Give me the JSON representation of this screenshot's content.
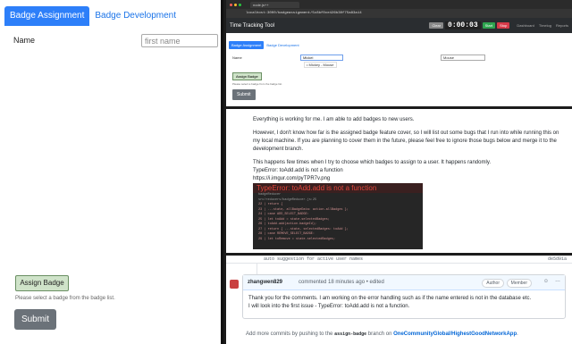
{
  "left_panel": {
    "tabs": [
      "Badge Assignment",
      "Badge Development"
    ],
    "name_label": "Name",
    "name_placeholder": "first name",
    "assign_button": "Assign Badge",
    "hint": "Please select a badge from the badge list.",
    "submit_button": "Submit"
  },
  "browser": {
    "tab_title": "node.js++",
    "url": "localhost:3000/badgeassignment/5c8bf0ce426b30f75a83a14",
    "app_title": "Time Tracking Tool",
    "clear_button": "Clear",
    "timer": "0:00:03",
    "start_button": "Start",
    "stop_button": "Stop",
    "nav_links": [
      "Dashboard",
      "Timelog",
      "Reports"
    ],
    "mini_tabs": [
      "Badge Assignment",
      "Badge Development"
    ],
    "name_label": "Name",
    "first_name_value": "Mickel",
    "dropdown_option": "• Mickey - Mouse",
    "last_name_value": "Mouse",
    "assign_button": "Assign Badge",
    "hint": "Please select a badge from the badge list.",
    "submit_button": "Submit",
    "colors": {
      "clear": "#888888",
      "start": "#2ea44f",
      "stop": "#d73a49"
    }
  },
  "comment": {
    "p1": "Everything is working for me. I am able to add badges to new users.",
    "p2": "However, I don't know how far is the assigned badge feature cover, so I will list out some bugs that I run into while running this on my local machine. If you are planning to cover them in the future, please feel free to ignore those bugs below and merge it to the development branch.",
    "p3": "This happens few times when I try to choose which badges to assign to a user. It happens randomly.",
    "p4": "TypeError: toAdd.add is not a function",
    "link": "https://i.imgur.com/pyTPR7v.png",
    "error_title": "TypeError: toAdd.add is not a function",
    "code_lines": [
      "badgeReducer",
      "src/reducers/badgeReducer.js:25",
      "22 |   return {",
      "23 |     ...state, allBadgeData: action.allBadges };",
      "24 |   case ADD_SELECT_BADGE:",
      "25 |     let toAdd = state.selectedBadges;",
      "26 |     toAdd.add(action.badgeId);",
      "27 |     return { ...state, selectedBadges: toAdd };",
      "28 |   case REMOVE_SELECT_BADGE:",
      "29 |     let toRemove = state.selectedBadges;"
    ]
  },
  "thread": {
    "commit_message": "auto suggestion for active user names",
    "commit_sha": "de5d91a",
    "author": "zhangwen829",
    "meta": "commented 18 minutes ago • edited",
    "badge_author": "Author",
    "badge_member": "Member",
    "body_1": "Thank you for the comments. I am working on the error handling such as if the name entered is not in the database etc.",
    "body_2": "I will look into the first issue - TypeError: toAdd.add is not a function.",
    "footer_prefix": "Add more commits by pushing to the",
    "footer_branch": "assign-badge",
    "footer_mid": "branch on",
    "footer_repo": "OneCommunityGlobal/HighestGoodNetworkApp",
    "footer_end": "."
  }
}
